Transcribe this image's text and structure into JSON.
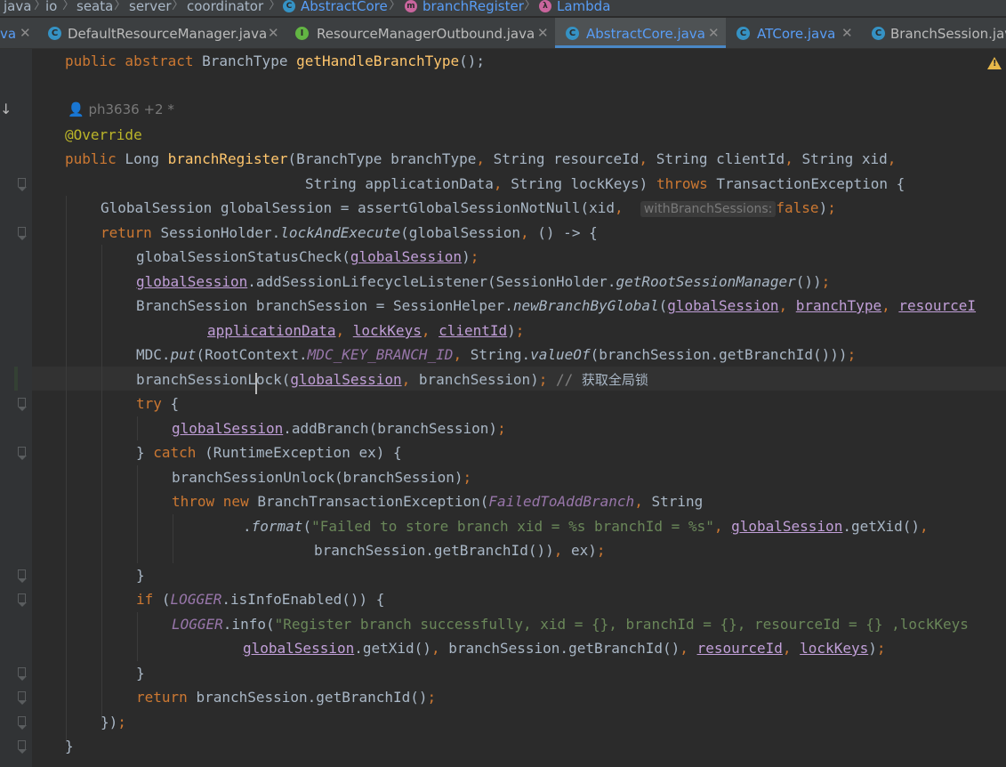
{
  "breadcrumb": {
    "items": [
      "java",
      "io",
      "seata",
      "server",
      "coordinator"
    ],
    "class_name": "AbstractCore",
    "method_name": "branchRegister",
    "lambda_name": "Lambda"
  },
  "tabs": [
    {
      "label": "va",
      "icon": "",
      "active": false
    },
    {
      "label": "DefaultResourceManager.java",
      "icon": "C",
      "active": false
    },
    {
      "label": "ResourceManagerOutbound.java",
      "icon": "I",
      "active": false
    },
    {
      "label": "AbstractCore.java",
      "icon": "C",
      "active": true
    },
    {
      "label": "ATCore.java",
      "icon": "C",
      "active": false
    },
    {
      "label": "BranchSession.java",
      "icon": "C",
      "active": false
    }
  ],
  "author_hint": "ph3636 +2 *",
  "inlay_hint": "withBranchSessions:",
  "inline_comment": "获取全局锁",
  "code": {
    "l0": "public abstract BranchType getHandleBranchType();",
    "l2": "@Override",
    "l3": "public Long branchRegister(BranchType branchType, String resourceId, String clientId, String xid,",
    "l4": "String applicationData, String lockKeys) throws TransactionException {",
    "l5": "GlobalSession globalSession = assertGlobalSessionNotNull(xid, false);",
    "l6": "return SessionHolder.lockAndExecute(globalSession, () -> {",
    "l7": "globalSessionStatusCheck(globalSession);",
    "l8": "globalSession.addSessionLifecycleListener(SessionHolder.getRootSessionManager());",
    "l9": "BranchSession branchSession = SessionHelper.newBranchByGlobal(globalSession, branchType, resourceI",
    "l10": "applicationData, lockKeys, clientId);",
    "l11": "MDC.put(RootContext.MDC_KEY_BRANCH_ID, String.valueOf(branchSession.getBranchId()));",
    "l12": "branchSessionLock(globalSession, branchSession); // 获取全局锁",
    "l13": "try {",
    "l14": "globalSession.addBranch(branchSession);",
    "l15": "} catch (RuntimeException ex) {",
    "l16": "branchSessionUnlock(branchSession);",
    "l17": "throw new BranchTransactionException(FailedToAddBranch, String",
    "l18": ".format(\"Failed to store branch xid = %s branchId = %s\", globalSession.getXid(),",
    "l19": "branchSession.getBranchId()), ex);",
    "l20": "}",
    "l21": "if (LOGGER.isInfoEnabled()) {",
    "l22": "LOGGER.info(\"Register branch successfully, xid = {}, branchId = {}, resourceId = {} ,lockKeys",
    "l23": "globalSession.getXid(), branchSession.getBranchId(), resourceId, lockKeys);",
    "l24": "}",
    "l25": "return branchSession.getBranchId();",
    "l26": "});",
    "l27": "}"
  },
  "colors": {
    "background": "#2b2b2b",
    "keyword": "#cc7832",
    "method": "#ffc66d",
    "string": "#6a8759",
    "field": "#9876aa",
    "annotation": "#bbb529",
    "accent": "#589df6"
  }
}
